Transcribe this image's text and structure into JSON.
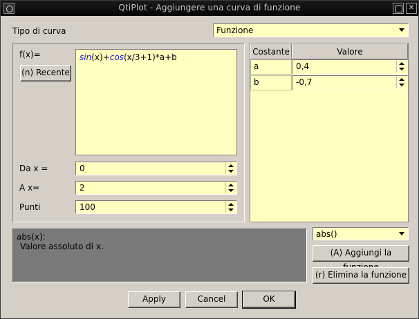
{
  "window": {
    "title": "QtiPlot - Aggiungere una curva di funzione"
  },
  "curve_type": {
    "label": "Tipo di curva",
    "value": "Funzione"
  },
  "function": {
    "label": "f(x)=",
    "recent_button": "(n) Recente",
    "expression": {
      "sin": "sin",
      "p1": "(x)+",
      "cos": "cos",
      "p2": "(x/3+1)*a+b"
    }
  },
  "range": {
    "from_label": "Da x =",
    "from_value": "0",
    "to_label": "A x=",
    "to_value": "2",
    "points_label": "Punti",
    "points_value": "100"
  },
  "constants": {
    "headers": {
      "name": "Costante",
      "value": "Valore"
    },
    "rows": [
      {
        "name": "a",
        "value": "0,4"
      },
      {
        "name": "b",
        "value": "-0,7"
      }
    ]
  },
  "help": {
    "title": "abs(x):",
    "text": "Valore assoluto di x."
  },
  "function_list": {
    "value": "abs()"
  },
  "buttons": {
    "add_function": "(A) Aggiungi la funzione",
    "remove_function": "(r) Elimina la funzione",
    "apply": "Apply",
    "cancel": "Cancel",
    "ok": "OK"
  },
  "colors": {
    "field_bg": "#ffffc0",
    "dialog_bg": "#d4d0c8",
    "function_name": "#1a1ad0",
    "help_bg": "#7a7a7a"
  }
}
